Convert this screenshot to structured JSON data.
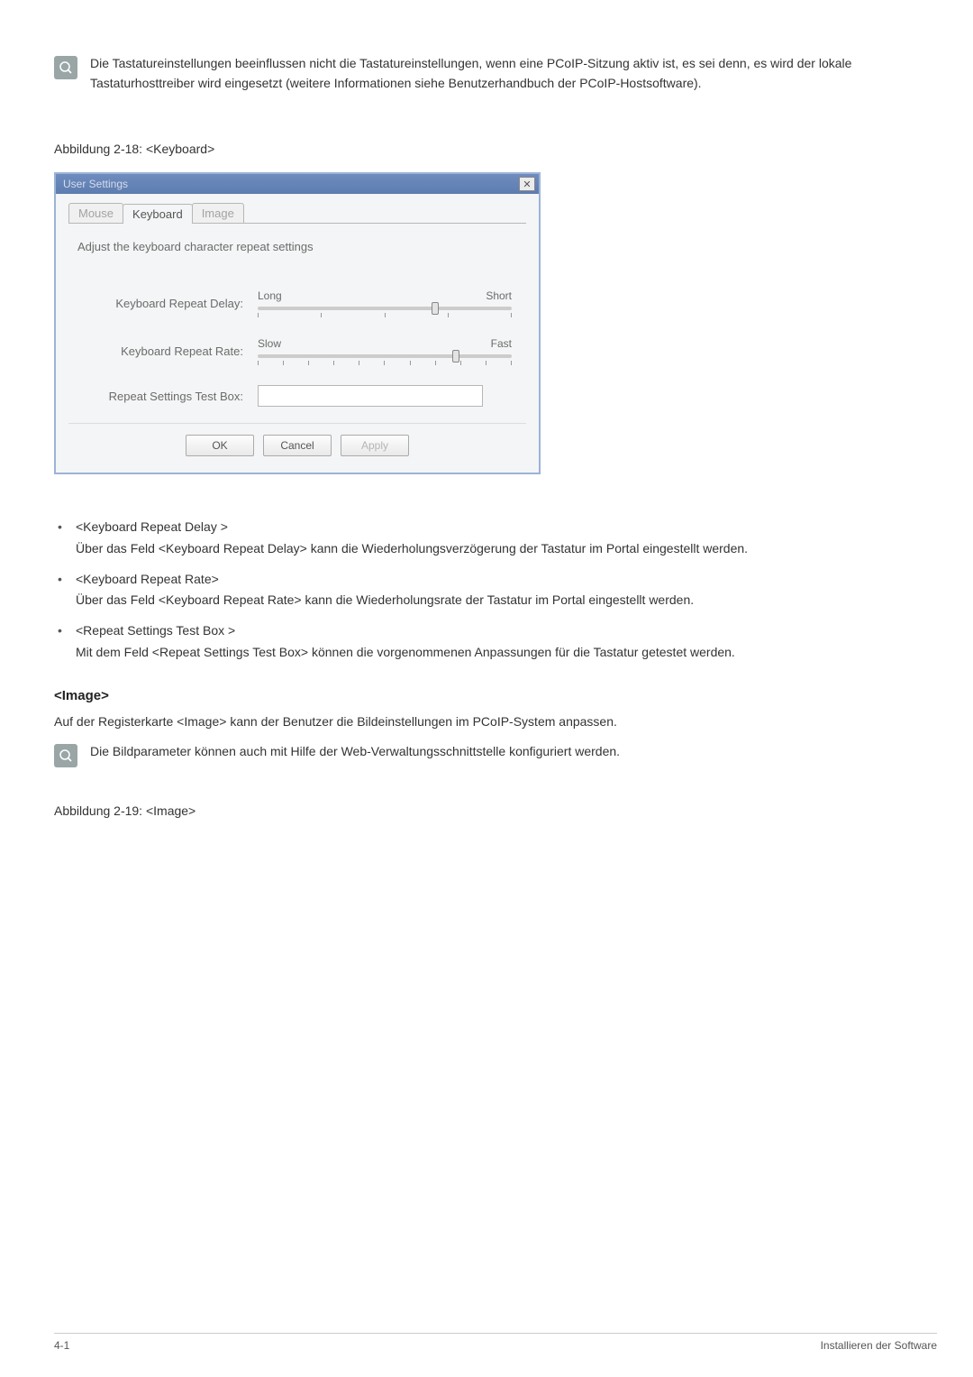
{
  "note1": "Die Tastatureinstellungen beeinflussen nicht die Tastatureinstellungen, wenn eine PCoIP-Sitzung aktiv ist, es sei denn, es wird der lokale Tastaturhosttreiber wird eingesetzt (weitere Informationen siehe Benutzerhandbuch der PCoIP-Hostsoftware).",
  "figure1": "Abbildung 2-18: <Keyboard>",
  "dialog": {
    "title": "User Settings",
    "tabs": {
      "mouse": "Mouse",
      "keyboard": "Keyboard",
      "image": "Image"
    },
    "instruction": "Adjust the keyboard character repeat settings",
    "labels": {
      "delay": "Keyboard Repeat Delay:",
      "rate": "Keyboard Repeat Rate:",
      "test": "Repeat Settings Test Box:"
    },
    "slider_delay": {
      "left": "Long",
      "right": "Short",
      "pos": 70
    },
    "slider_rate": {
      "left": "Slow",
      "right": "Fast",
      "pos": 78
    },
    "buttons": {
      "ok": "OK",
      "cancel": "Cancel",
      "apply": "Apply"
    }
  },
  "list": {
    "delay_title": "<Keyboard Repeat Delay >",
    "delay_body": "Über das Feld <Keyboard Repeat Delay> kann die Wiederholungsverzögerung der Tastatur im Portal eingestellt werden.",
    "rate_title": "<Keyboard Repeat Rate>",
    "rate_body": "Über das Feld <Keyboard Repeat Rate> kann die Wiederholungsrate der Tastatur im Portal eingestellt werden.",
    "test_title": "<Repeat Settings Test Box >",
    "test_body": "Mit dem Feld <Repeat Settings Test Box> können die vorgenommenen Anpassungen für die Tastatur getestet werden."
  },
  "image_section": {
    "heading": "<Image>",
    "body": "Auf der Registerkarte <Image> kann der Benutzer die Bildeinstellungen im PCoIP-System anpassen.",
    "note": "Die Bildparameter können auch mit Hilfe der Web-Verwaltungsschnittstelle konfiguriert werden.",
    "figure": "Abbildung 2-19: <Image>"
  },
  "footer": {
    "left": "4-1",
    "right": "Installieren der Software"
  }
}
